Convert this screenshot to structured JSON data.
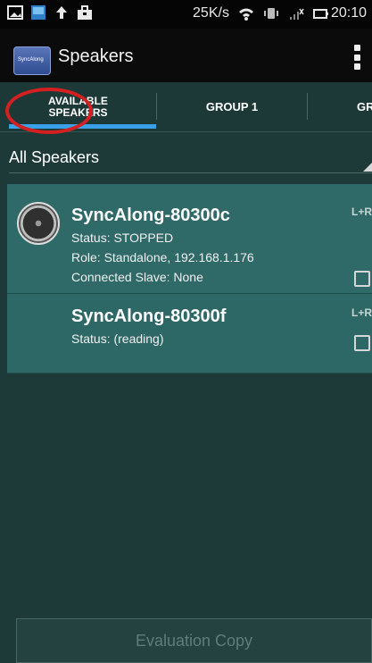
{
  "status_bar": {
    "speed": "25K/s",
    "time": "20:10",
    "icons": [
      "image-icon",
      "photo-icon",
      "upload-icon",
      "briefcase-icon",
      "wifi-icon",
      "vibrate-icon",
      "signal-icon",
      "battery-icon"
    ]
  },
  "app": {
    "title": "Speakers",
    "icon_text": "SyncAlong"
  },
  "tabs": [
    {
      "label_line1": "AVAILABLE",
      "label_line2": "SPEAKERS"
    },
    {
      "label": "GROUP 1"
    },
    {
      "label": "GR"
    }
  ],
  "filter": {
    "label": "All Speakers"
  },
  "speakers": [
    {
      "name": "SyncAlong-80300c",
      "status": "Status: STOPPED",
      "role": "Role: Standalone,  192.168.1.176",
      "slave": "Connected Slave: None",
      "channel": "L+R"
    },
    {
      "name": "SyncAlong-80300f",
      "status": "Status: (reading)",
      "channel": "L+R"
    }
  ],
  "footer": {
    "evaluation_label": "Evaluation Copy"
  },
  "colors": {
    "accent": "#3aa0e8",
    "item_bg": "#2f6a68",
    "bg": "#1d3a39",
    "annotation": "#d42020"
  }
}
